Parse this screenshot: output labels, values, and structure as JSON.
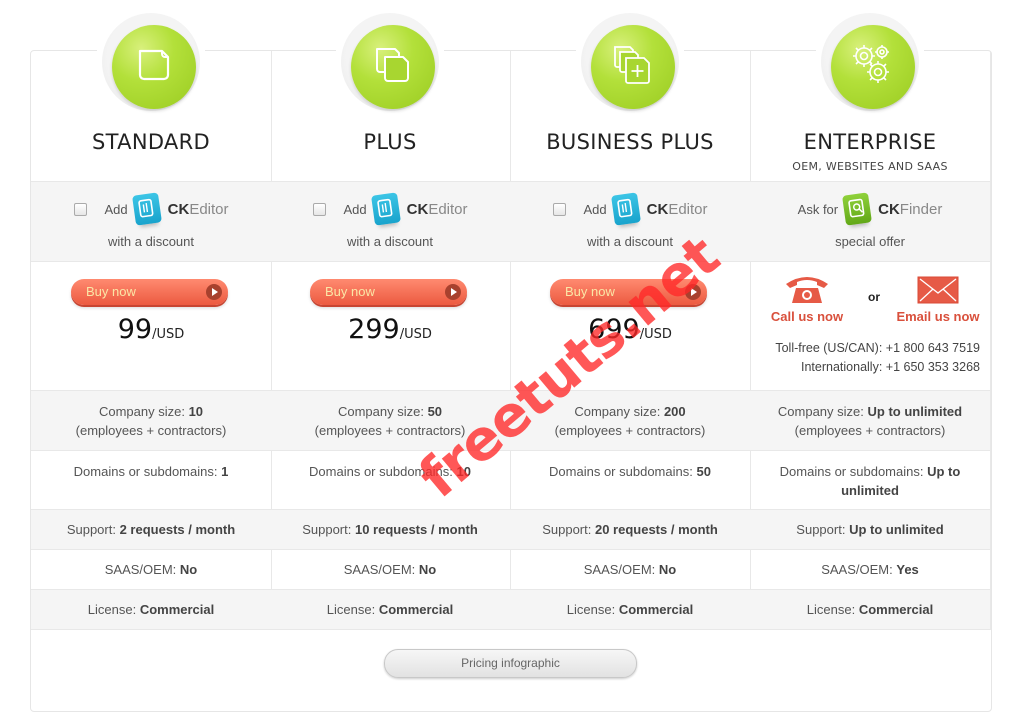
{
  "plans": [
    {
      "id": "standard",
      "title": "STANDARD",
      "subtitle": "",
      "icon": "single-document-icon",
      "addon": {
        "checkbox_checked": false,
        "prefix": "Add",
        "logo_bold": "CK",
        "logo_light": "Editor",
        "note": "with a discount"
      },
      "buy_label": "Buy now",
      "price": "99",
      "currency": "/USD",
      "company_size_label": "Company size:",
      "company_size": "10",
      "company_size_note": "(employees + contractors)",
      "domains_label": "Domains or subdomains:",
      "domains": "1",
      "support_label": "Support:",
      "support": "2 requests / month",
      "saas_label": "SAAS/OEM:",
      "saas": "No",
      "license_label": "License:",
      "license": "Commercial"
    },
    {
      "id": "plus",
      "title": "PLUS",
      "subtitle": "",
      "icon": "two-documents-icon",
      "addon": {
        "checkbox_checked": false,
        "prefix": "Add",
        "logo_bold": "CK",
        "logo_light": "Editor",
        "note": "with a discount"
      },
      "buy_label": "Buy now",
      "price": "299",
      "currency": "/USD",
      "company_size_label": "Company size:",
      "company_size": "50",
      "company_size_note": "(employees + contractors)",
      "domains_label": "Domains or subdomains:",
      "domains": "10",
      "support_label": "Support:",
      "support": "10 requests / month",
      "saas_label": "SAAS/OEM:",
      "saas": "No",
      "license_label": "License:",
      "license": "Commercial"
    },
    {
      "id": "business-plus",
      "title": "BUSINESS PLUS",
      "subtitle": "",
      "icon": "multiple-documents-plus-icon",
      "addon": {
        "checkbox_checked": false,
        "prefix": "Add",
        "logo_bold": "CK",
        "logo_light": "Editor",
        "note": "with a discount"
      },
      "buy_label": "Buy now",
      "price": "699",
      "currency": "/USD",
      "company_size_label": "Company size:",
      "company_size": "200",
      "company_size_note": "(employees + contractors)",
      "domains_label": "Domains or subdomains:",
      "domains": "50",
      "support_label": "Support:",
      "support": "20 requests / month",
      "saas_label": "SAAS/OEM:",
      "saas": "No",
      "license_label": "License:",
      "license": "Commercial"
    },
    {
      "id": "enterprise",
      "title": "ENTERPRISE",
      "subtitle": "OEM, WEBSITES AND SAAS",
      "icon": "gears-icon",
      "addon": {
        "prefix": "Ask for",
        "logo_bold": "CK",
        "logo_light": "Finder",
        "note": "special offer"
      },
      "contact": {
        "call_label": "Call us now",
        "or_label": "or",
        "email_label": "Email us now",
        "tollfree_label": "Toll-free (US/CAN):",
        "tollfree_number": "+1 800 643 7519",
        "intl_label": "Internationally:",
        "intl_number": "+1 650 353 3268"
      },
      "company_size_label": "Company size:",
      "company_size": "Up to unlimited",
      "company_size_note": "(employees + contractors)",
      "domains_label": "Domains or subdomains:",
      "domains": "Up to unlimited",
      "support_label": "Support:",
      "support": "Up to unlimited",
      "saas_label": "SAAS/OEM:",
      "saas": "Yes",
      "license_label": "License:",
      "license": "Commercial"
    }
  ],
  "footer": {
    "infographic_label": "Pricing infographic"
  },
  "watermark": "freetuts.net",
  "colors": {
    "accent_green": "#a6d42a",
    "buy_red": "#ec5a40",
    "contact_red": "#d9503c",
    "ckeditor_blue": "#19a3cc",
    "ckfinder_green": "#62a818"
  }
}
